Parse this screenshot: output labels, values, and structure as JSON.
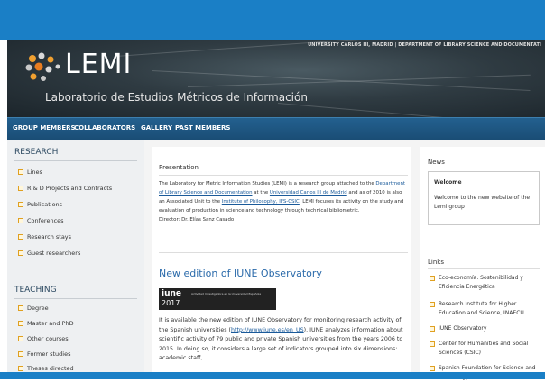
{
  "header": {
    "university_line": "UNIVERSITY CARLOS III, MADRID | DEPARTMENT OF LIBRARY SCIENCE AND DOCUMENTATI",
    "logo_text": "LEMI",
    "subtitle": "Laboratorio de Estudios Métricos de Información"
  },
  "nav": {
    "items": [
      "GROUP MEMBERS",
      "COLLABORATORS",
      "GALLERY",
      "PAST MEMBERS"
    ]
  },
  "sidebar": {
    "research_title": "RESEARCH",
    "research_items": [
      "Lines",
      "R & D Projects and Contracts",
      "Publications",
      "Conferences",
      "Research stays",
      "Guest researchers"
    ],
    "teaching_title": "TEACHING",
    "teaching_items": [
      "Degree",
      "Master and PhD",
      "Other courses",
      "Former studies",
      "Theses directed"
    ]
  },
  "main": {
    "presentation_title": "Presentation",
    "presentation": {
      "t1": "The Laboratory for Metric Information Studies (LEMI) is a research group attached to the ",
      "link1": "Department of Library Science and Documentation",
      "t2": " at the ",
      "link2": "Universidad Carlos III de Madrid",
      "t3": " and as of 2010 is also an Associated Unit to the ",
      "link3": "Institute of Philosophy, IFS-CSIC",
      "t4": ". LEMI focuses its activity on the study and evaluation of production in science and technology through technical bibliometric.",
      "director": "Director: Dr. Elías Sanz Casado"
    },
    "news_headline": "New edition of IUNE Observatory",
    "iune_logo": "iune",
    "iune_year": "2017",
    "iune_caption": "Actividad Investigadora en la Universidad Española",
    "article": {
      "t1": "It is available the new edition of IUNE Observatory for monitoring research activity of the Spanish universities (",
      "link": "http://www.iune.es/en_US",
      "t2": "). IUNE analyzes information about scientific activity of 79 public and private Spanish universities from the years 2006 to 2015. In doing so, it considers a large set of indicators grouped into six dimensions: academic staff,"
    }
  },
  "right": {
    "news_title": "News",
    "welcome_title": "Welcome",
    "welcome_text": "Welcome to the new website of the Lemi group",
    "links_title": "Links",
    "links": [
      "Eco-economía. Sostenibilidad y Eficiencia Energética",
      "Research Institute for Higher Education and Science, INAECU",
      "IUNE Observatory",
      "Center for Humanities and Social Sciences (CSIC)",
      "Spanish Foundation for Science and Technology, FECYT"
    ]
  },
  "colors": {
    "frame_blue": "#1a7fc6",
    "nav_blue": "#1e5784",
    "link_blue": "#1a5a9a",
    "checkbox_orange": "#e0a020"
  }
}
